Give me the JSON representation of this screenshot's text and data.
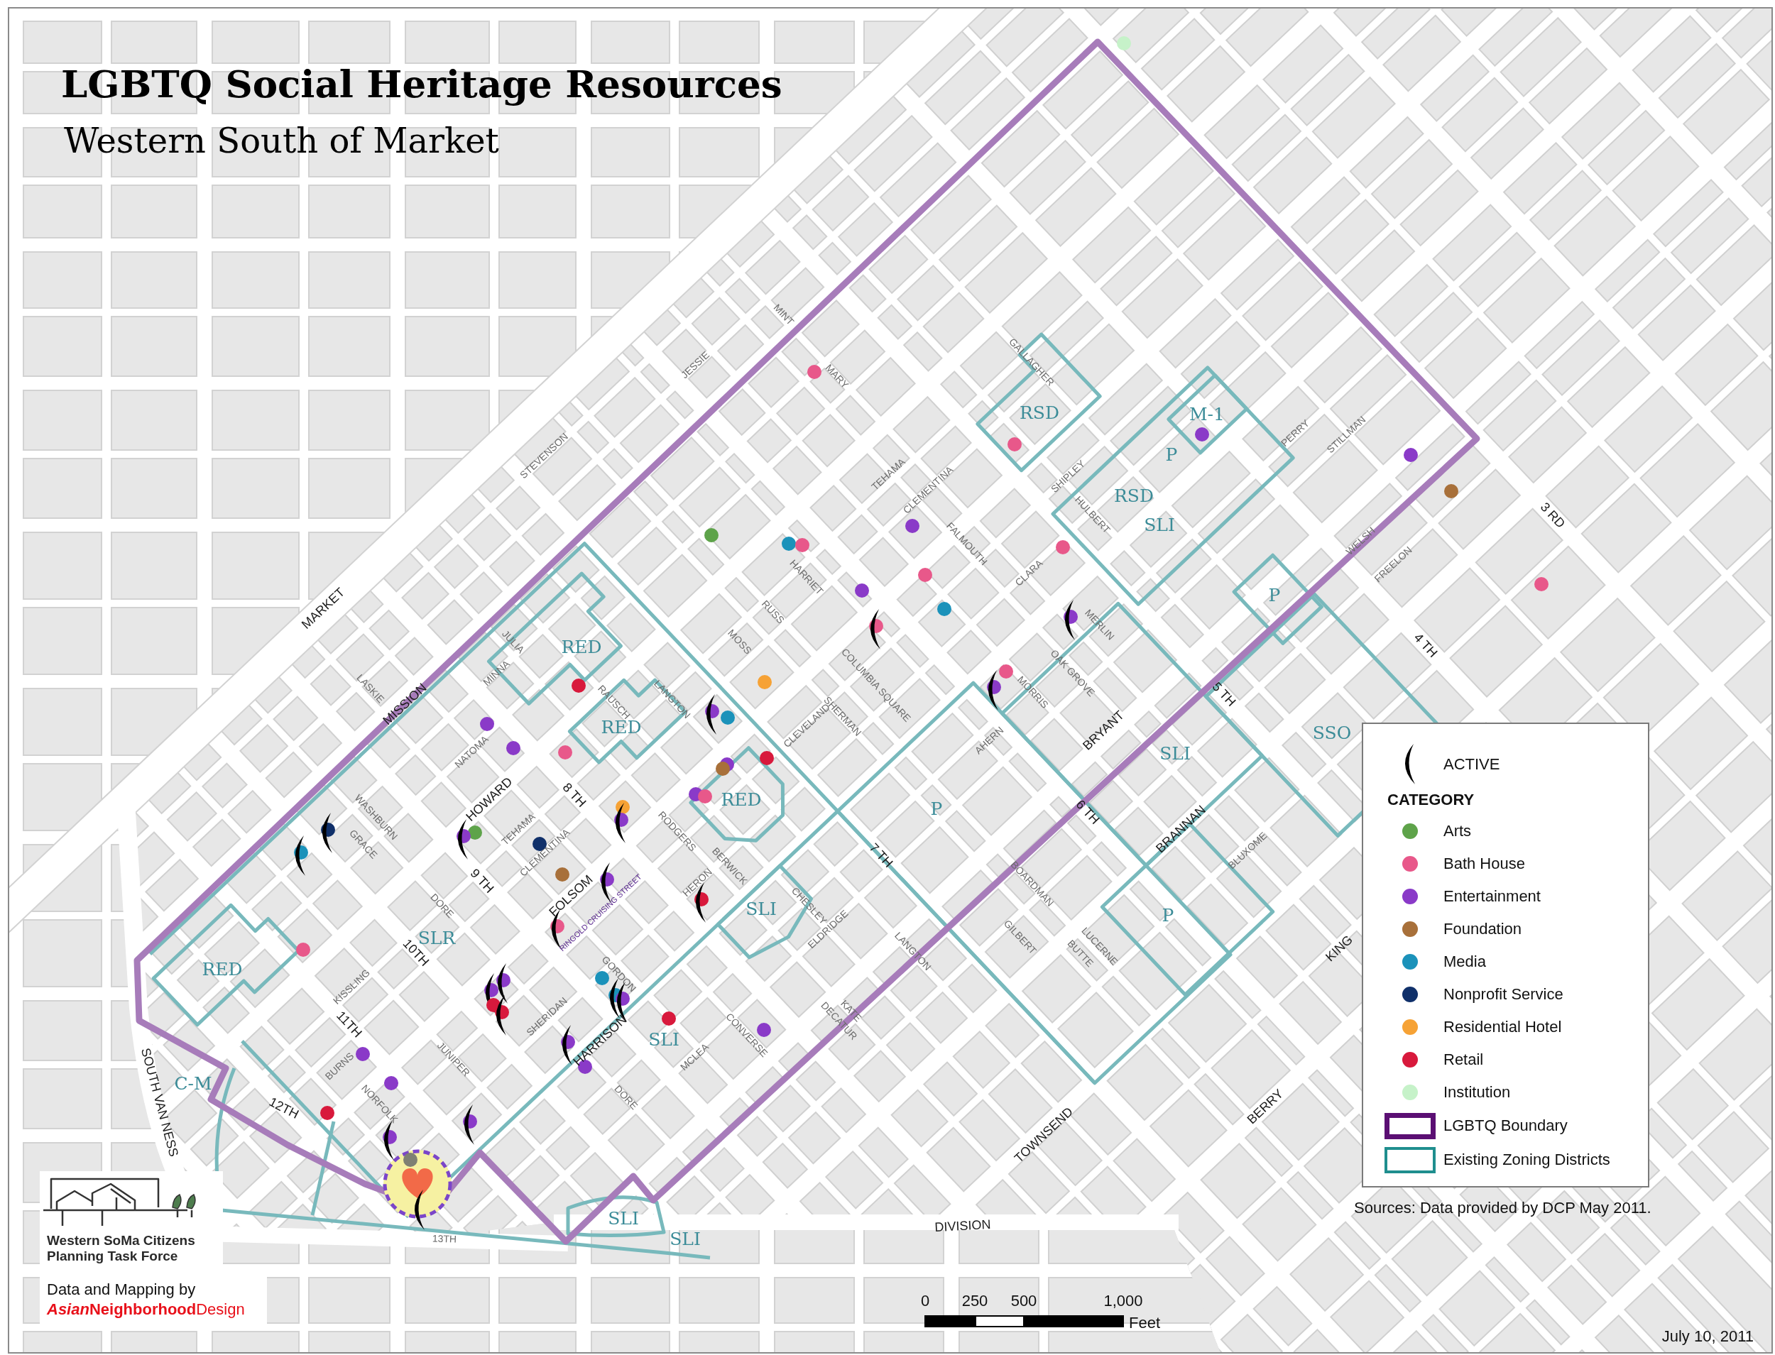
{
  "title": "LGBTQ Social Heritage Resources",
  "subtitle": "Western South of Market",
  "street_labels": [
    {
      "text": "MINT",
      "kind": "minor"
    },
    {
      "text": "JESSIE",
      "kind": "minor"
    },
    {
      "text": "GALLAGHER",
      "kind": "minor"
    },
    {
      "text": "MARY",
      "kind": "minor"
    },
    {
      "text": "PERRY",
      "kind": "minor"
    },
    {
      "text": "STILLMAN",
      "kind": "minor"
    },
    {
      "text": "STEVENSON",
      "kind": "minor"
    },
    {
      "text": "TEHAMA",
      "kind": "minor"
    },
    {
      "text": "SHIPLEY",
      "kind": "minor"
    },
    {
      "text": "CLEMENTINA",
      "kind": "minor"
    },
    {
      "text": "3 RD",
      "kind": "major"
    },
    {
      "text": "HULBERT",
      "kind": "minor"
    },
    {
      "text": "WELSH",
      "kind": "minor"
    },
    {
      "text": "FALMOUTH",
      "kind": "minor"
    },
    {
      "text": "HARRIET",
      "kind": "minor"
    },
    {
      "text": "FREELON",
      "kind": "minor"
    },
    {
      "text": "CLARA",
      "kind": "minor"
    },
    {
      "text": "MARKET",
      "kind": "major"
    },
    {
      "text": "RUSS",
      "kind": "minor"
    },
    {
      "text": "MERLIN",
      "kind": "minor"
    },
    {
      "text": "JULIA",
      "kind": "minor"
    },
    {
      "text": "MOSS",
      "kind": "minor"
    },
    {
      "text": "4 TH",
      "kind": "major"
    },
    {
      "text": "OAK GROVE",
      "kind": "minor"
    },
    {
      "text": "MINNA",
      "kind": "minor"
    },
    {
      "text": "COLUMBIA SQUARE",
      "kind": "minor"
    },
    {
      "text": "LASKIE",
      "kind": "minor"
    },
    {
      "text": "MORRIS",
      "kind": "minor"
    },
    {
      "text": "5 TH",
      "kind": "major"
    },
    {
      "text": "LANGTON",
      "kind": "minor"
    },
    {
      "text": "RAUSCH",
      "kind": "minor"
    },
    {
      "text": "MISSION",
      "kind": "major"
    },
    {
      "text": "SHERMAN",
      "kind": "minor"
    },
    {
      "text": "CLEVELAND",
      "kind": "minor"
    },
    {
      "text": "BRYANT",
      "kind": "major"
    },
    {
      "text": "AHERN",
      "kind": "minor"
    },
    {
      "text": "NATOMA",
      "kind": "minor"
    },
    {
      "text": "8 TH",
      "kind": "major"
    },
    {
      "text": "HOWARD",
      "kind": "major"
    },
    {
      "text": "6 TH",
      "kind": "major"
    },
    {
      "text": "WASHBURN",
      "kind": "minor"
    },
    {
      "text": "BRANNAN",
      "kind": "major"
    },
    {
      "text": "TEHAMA",
      "kind": "minor"
    },
    {
      "text": "RODGERS",
      "kind": "minor"
    },
    {
      "text": "GRACE",
      "kind": "minor"
    },
    {
      "text": "BLUXOME",
      "kind": "minor"
    },
    {
      "text": "CLEMENTINA",
      "kind": "minor"
    },
    {
      "text": "7 TH",
      "kind": "major"
    },
    {
      "text": "BERWICK",
      "kind": "minor"
    },
    {
      "text": "9 TH",
      "kind": "major"
    },
    {
      "text": "HERON",
      "kind": "minor"
    },
    {
      "text": "BOARDMAN",
      "kind": "minor"
    },
    {
      "text": "FOLSOM",
      "kind": "major"
    },
    {
      "text": "DORE",
      "kind": "minor"
    },
    {
      "text": "CHESLEY",
      "kind": "minor"
    },
    {
      "text": "RINGOLD CRUISING STREET",
      "kind": "highlight"
    },
    {
      "text": "ELDRIDGE",
      "kind": "minor"
    },
    {
      "text": "GILBERT",
      "kind": "minor"
    },
    {
      "text": "LUCERNE",
      "kind": "minor"
    },
    {
      "text": "KING",
      "kind": "major"
    },
    {
      "text": "LANGTON",
      "kind": "minor"
    },
    {
      "text": "10TH",
      "kind": "major"
    },
    {
      "text": "BUTTE",
      "kind": "minor"
    },
    {
      "text": "GORDON",
      "kind": "minor"
    },
    {
      "text": "KISSLING",
      "kind": "minor"
    },
    {
      "text": "KATE",
      "kind": "minor"
    },
    {
      "text": "SHERIDAN",
      "kind": "minor"
    },
    {
      "text": "DECATUR",
      "kind": "minor"
    },
    {
      "text": "11TH",
      "kind": "major"
    },
    {
      "text": "CONVERSE",
      "kind": "minor"
    },
    {
      "text": "HARRISON",
      "kind": "major"
    },
    {
      "text": "MCLEA",
      "kind": "minor"
    },
    {
      "text": "BURNS",
      "kind": "minor"
    },
    {
      "text": "JUNIPER",
      "kind": "minor"
    },
    {
      "text": "DORE",
      "kind": "minor"
    },
    {
      "text": "SOUTH VAN NESS",
      "kind": "major"
    },
    {
      "text": "BERRY",
      "kind": "major"
    },
    {
      "text": "12TH",
      "kind": "major"
    },
    {
      "text": "NORFOLK",
      "kind": "minor"
    },
    {
      "text": "TOWNSEND",
      "kind": "major"
    },
    {
      "text": "DIVISION",
      "kind": "major"
    },
    {
      "text": "13TH",
      "kind": "minor"
    }
  ],
  "zoning_labels": [
    "RSD",
    "M-1",
    "P",
    "RSD",
    "SLI",
    "P",
    "RED",
    "RED",
    "SSO",
    "SLI",
    "RED",
    "P",
    "SLI",
    "P",
    "SLR",
    "RED",
    "SLI",
    "C-M",
    "SLI",
    "SLI"
  ],
  "points": [
    {
      "color": "#c6f2c9",
      "active": false
    },
    {
      "color": "#e8588a",
      "active": false
    },
    {
      "color": "#e8588a",
      "active": false
    },
    {
      "color": "#8a3ac8",
      "active": false
    },
    {
      "color": "#8a3ac8",
      "active": false
    },
    {
      "color": "#a8703a",
      "active": false
    },
    {
      "color": "#8a3ac8",
      "active": false
    },
    {
      "color": "#5ea34a",
      "active": false
    },
    {
      "color": "#1b92ba",
      "active": false
    },
    {
      "color": "#e8588a",
      "active": false
    },
    {
      "color": "#e8588a",
      "active": false
    },
    {
      "color": "#e8588a",
      "active": false
    },
    {
      "color": "#e8588a",
      "active": false
    },
    {
      "color": "#8a3ac8",
      "active": false
    },
    {
      "color": "#1b92ba",
      "active": false
    },
    {
      "color": "#8a3ac8",
      "active": true
    },
    {
      "color": "#e8588a",
      "active": true
    },
    {
      "color": "#e8588a",
      "active": false
    },
    {
      "color": "#f6a235",
      "active": false
    },
    {
      "color": "#d8193c",
      "active": false
    },
    {
      "color": "#8a3ac8",
      "active": true
    },
    {
      "color": "#8a3ac8",
      "active": true
    },
    {
      "color": "#1b92ba",
      "active": false
    },
    {
      "color": "#8a3ac8",
      "active": false
    },
    {
      "color": "#8a3ac8",
      "active": false
    },
    {
      "color": "#e8588a",
      "active": false
    },
    {
      "color": "#d8193c",
      "active": false
    },
    {
      "color": "#8a3ac8",
      "active": false
    },
    {
      "color": "#a8703a",
      "active": false
    },
    {
      "color": "#8a3ac8",
      "active": false
    },
    {
      "color": "#e8588a",
      "active": false
    },
    {
      "color": "#f6a235",
      "active": false
    },
    {
      "color": "#8a3ac8",
      "active": true
    },
    {
      "color": "#10306a",
      "active": true
    },
    {
      "color": "#5ea34a",
      "active": false
    },
    {
      "color": "#8a3ac8",
      "active": true
    },
    {
      "color": "#10306a",
      "active": false
    },
    {
      "color": "#1b92ba",
      "active": true
    },
    {
      "color": "#a8703a",
      "active": false
    },
    {
      "color": "#8a3ac8",
      "active": true
    },
    {
      "color": "#d8193c",
      "active": true
    },
    {
      "color": "#e8588a",
      "active": true
    },
    {
      "color": "#e8588a",
      "active": false
    },
    {
      "color": "#1b92ba",
      "active": false
    },
    {
      "color": "#8a3ac8",
      "active": true
    },
    {
      "color": "#8a3ac8",
      "active": true
    },
    {
      "color": "#1b92ba",
      "active": true
    },
    {
      "color": "#8a3ac8",
      "active": true
    },
    {
      "color": "#d8193c",
      "active": false
    },
    {
      "color": "#d8193c",
      "active": true
    },
    {
      "color": "#d8193c",
      "active": false
    },
    {
      "color": "#8a3ac8",
      "active": false
    },
    {
      "color": "#8a3ac8",
      "active": true
    },
    {
      "color": "#8a3ac8",
      "active": false
    },
    {
      "color": "#8a3ac8",
      "active": false
    },
    {
      "color": "#8a3ac8",
      "active": false
    },
    {
      "color": "#d8193c",
      "active": false
    },
    {
      "color": "#8a3ac8",
      "active": true
    },
    {
      "color": "#8a3ac8",
      "active": true
    },
    {
      "color": "#7f8073",
      "active": false
    }
  ],
  "legend": {
    "active_label": "ACTIVE",
    "category_heading": "CATEGORY",
    "categories": [
      {
        "label": "Arts",
        "color": "#5ea34a"
      },
      {
        "label": "Bath House",
        "color": "#e8588a"
      },
      {
        "label": "Entertainment",
        "color": "#8a3ac8"
      },
      {
        "label": "Foundation",
        "color": "#a8703a"
      },
      {
        "label": "Media",
        "color": "#1b92ba"
      },
      {
        "label": "Nonprofit Service",
        "color": "#10306a"
      },
      {
        "label": "Residential Hotel",
        "color": "#f6a235"
      },
      {
        "label": "Retail",
        "color": "#d8193c"
      },
      {
        "label": "Institution",
        "color": "#c6f2c9"
      }
    ],
    "line_items": [
      {
        "label": "LGBTQ Boundary",
        "kind": "boundary",
        "color": "#5b0f73"
      },
      {
        "label": "Existing Zoning Districts",
        "kind": "zoning",
        "color": "#1f8e8e"
      }
    ]
  },
  "sources": "Sources: Data provided by DCP May 2011.",
  "scale_bar": {
    "labels": [
      "0",
      "250",
      "500",
      "1,000"
    ],
    "unit": "Feet"
  },
  "date": "July 10, 2011",
  "logo": {
    "lines": [
      "Western SoMa Citizens",
      "Planning Task Force"
    ]
  },
  "credit": {
    "text": "Data and Mapping by",
    "organization_parts": [
      "Asian",
      "Neighborhood",
      "Design"
    ]
  }
}
